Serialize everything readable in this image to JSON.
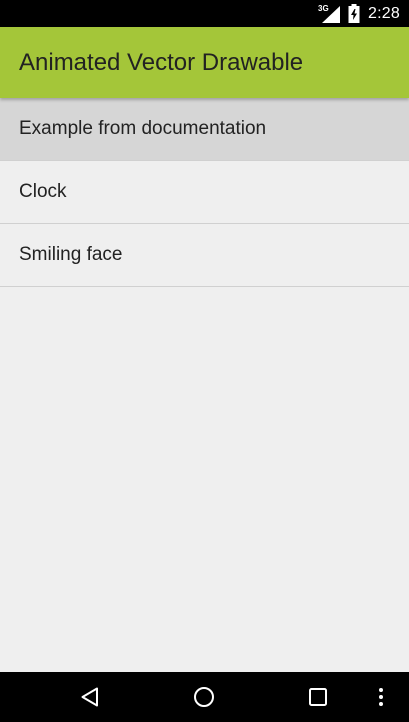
{
  "status_bar": {
    "network_type": "3G",
    "time": "2:28",
    "icons": [
      "signal-icon",
      "battery-icon"
    ]
  },
  "app_bar": {
    "title": "Animated Vector Drawable",
    "color": "#a4c639"
  },
  "list": {
    "items": [
      {
        "label": "Example from documentation",
        "pressed": true
      },
      {
        "label": "Clock",
        "pressed": false
      },
      {
        "label": "Smiling face",
        "pressed": false
      }
    ]
  },
  "nav_bar": {
    "buttons": [
      "back-icon",
      "home-icon",
      "recents-icon",
      "overflow-menu-icon"
    ]
  }
}
